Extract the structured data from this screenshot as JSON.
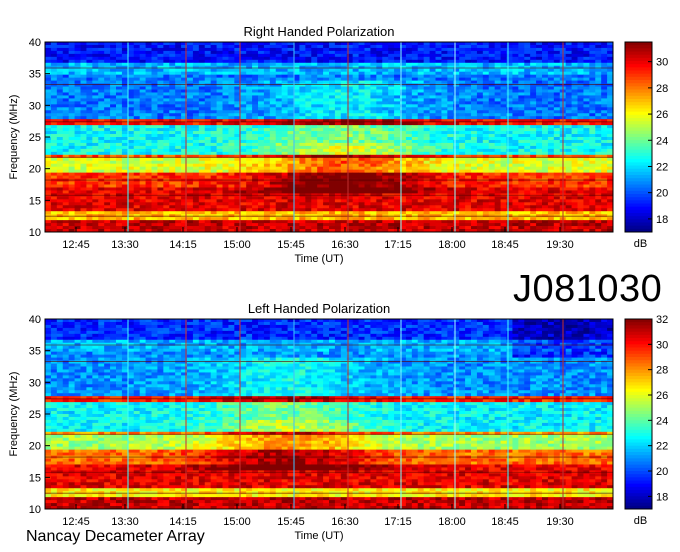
{
  "source_id": "J081030",
  "footer_label": "Nancay Decameter Array",
  "chart_data": [
    {
      "type": "heatmap",
      "title": "Right Handed Polarization",
      "xlabel": "Time (UT)",
      "ylabel": "Frequency (MHz)",
      "x_ticks": [
        "12:45",
        "13:30",
        "14:15",
        "15:00",
        "15:45",
        "16:30",
        "17:15",
        "18:00",
        "18:45",
        "19:30"
      ],
      "y_ticks": [
        10,
        15,
        20,
        25,
        30,
        35,
        40
      ],
      "ylim": [
        10,
        40
      ],
      "colorbar": {
        "label": "dB",
        "ticks": [
          18,
          20,
          22,
          24,
          26,
          28,
          30
        ],
        "range": [
          17,
          31.5
        ]
      },
      "vertical_markers": [
        "13:30",
        "14:15",
        "15:00",
        "15:45",
        "16:30",
        "17:15",
        "18:00",
        "18:45",
        "19:30"
      ],
      "bands_mhz": [
        {
          "lo": 10.0,
          "hi": 12.0,
          "level": 30.5
        },
        {
          "lo": 12.0,
          "hi": 13.2,
          "level": 27.0
        },
        {
          "lo": 13.2,
          "hi": 17.0,
          "level": 30.0
        },
        {
          "lo": 17.0,
          "hi": 19.5,
          "level": 29.0
        },
        {
          "lo": 19.5,
          "hi": 21.5,
          "level": 25.5
        },
        {
          "lo": 21.5,
          "hi": 22.3,
          "level": 28.5
        },
        {
          "lo": 22.3,
          "hi": 26.8,
          "level": 22.5
        },
        {
          "lo": 26.8,
          "hi": 28.0,
          "level": 29.5
        },
        {
          "lo": 28.0,
          "hi": 35.0,
          "level": 20.5
        },
        {
          "lo": 35.0,
          "hi": 36.5,
          "level": 21.5
        },
        {
          "lo": 36.5,
          "hi": 40.0,
          "level": 19.0
        }
      ]
    },
    {
      "type": "heatmap",
      "title": "Left Handed Polarization",
      "xlabel": "Time (UT)",
      "ylabel": "Frequency (MHz)",
      "x_ticks": [
        "12:45",
        "13:30",
        "14:15",
        "15:00",
        "15:45",
        "16:30",
        "17:15",
        "18:00",
        "18:45",
        "19:30"
      ],
      "y_ticks": [
        10,
        15,
        20,
        25,
        30,
        35,
        40
      ],
      "ylim": [
        10,
        40
      ],
      "colorbar": {
        "label": "dB",
        "ticks": [
          18,
          20,
          22,
          24,
          26,
          28,
          30,
          32
        ],
        "range": [
          17,
          32
        ]
      },
      "vertical_markers": [
        "13:30",
        "14:15",
        "15:00",
        "15:45",
        "16:30",
        "17:15",
        "18:00",
        "18:45",
        "19:30"
      ],
      "bands_mhz": [
        {
          "lo": 10.0,
          "hi": 12.0,
          "level": 31.0
        },
        {
          "lo": 12.0,
          "hi": 13.2,
          "level": 26.5
        },
        {
          "lo": 13.2,
          "hi": 17.0,
          "level": 30.5
        },
        {
          "lo": 17.0,
          "hi": 19.5,
          "level": 28.5
        },
        {
          "lo": 19.5,
          "hi": 21.5,
          "level": 25.0
        },
        {
          "lo": 21.5,
          "hi": 22.3,
          "level": 28.0
        },
        {
          "lo": 22.3,
          "hi": 26.8,
          "level": 22.5
        },
        {
          "lo": 26.8,
          "hi": 28.0,
          "level": 29.5
        },
        {
          "lo": 28.0,
          "hi": 35.0,
          "level": 21.0
        },
        {
          "lo": 35.0,
          "hi": 36.5,
          "level": 21.5
        },
        {
          "lo": 36.5,
          "hi": 40.0,
          "level": 19.5
        }
      ]
    }
  ]
}
